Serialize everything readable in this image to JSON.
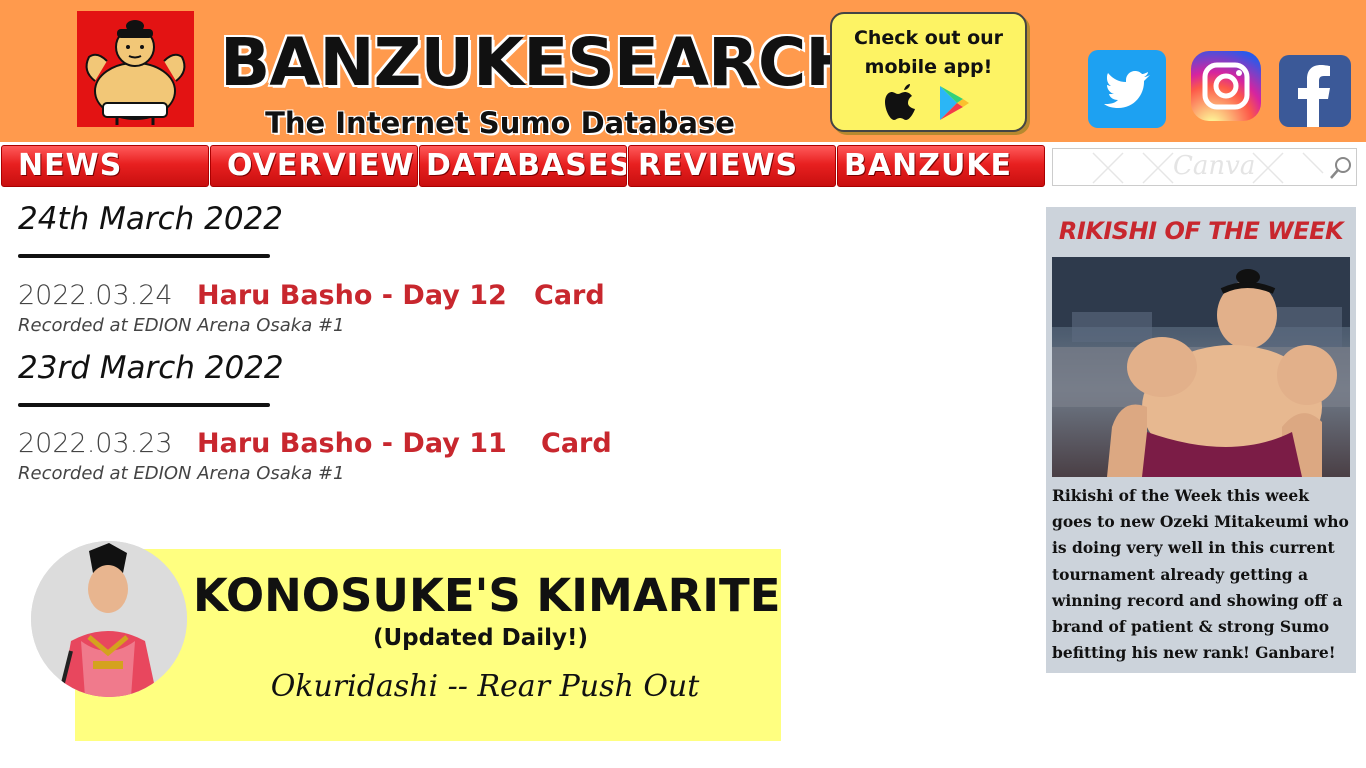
{
  "header": {
    "site_title": "BANZUKESEARCH",
    "site_subtitle": "The Internet Sumo Database",
    "app_promo": "Check out our mobile app!"
  },
  "nav": {
    "items": [
      {
        "label": "NEWS"
      },
      {
        "label": "OVERVIEW"
      },
      {
        "label": "DATABASES"
      },
      {
        "label": "REVIEWS"
      },
      {
        "label": "BANZUKE"
      }
    ],
    "search_watermark": "Canva",
    "search_placeholder": ""
  },
  "news": [
    {
      "date": "24th March 2022",
      "id": "2022.03.24",
      "title": "Haru Basho - Day 12",
      "card": "Card",
      "venue": "Recorded at EDION Arena Osaka #1"
    },
    {
      "date": "23rd March 2022",
      "id": "2022.03.23",
      "title": "Haru Basho - Day 11",
      "card": "Card",
      "venue": "Recorded at EDION Arena Osaka #1"
    }
  ],
  "kimarite": {
    "title": "KONOSUKE'S KIMARITE",
    "subtitle": "(Updated Daily!)",
    "move": "Okuridashi -- Rear Push Out"
  },
  "sidebar": {
    "title": "RIKISHI OF THE WEEK",
    "text": "Rikishi of the Week this week goes to new Ozeki Mitakeumi who is doing very well in this current tournament already getting a winning record and showing off a brand of patient & strong Sumo befitting his new rank! Ganbare!"
  },
  "colors": {
    "header_bg": "#ff9a4d",
    "nav_red": "#e82020",
    "link_red": "#c8272e",
    "kimarite_bg": "#ffff80",
    "sidebar_bg": "#ccd3db"
  }
}
